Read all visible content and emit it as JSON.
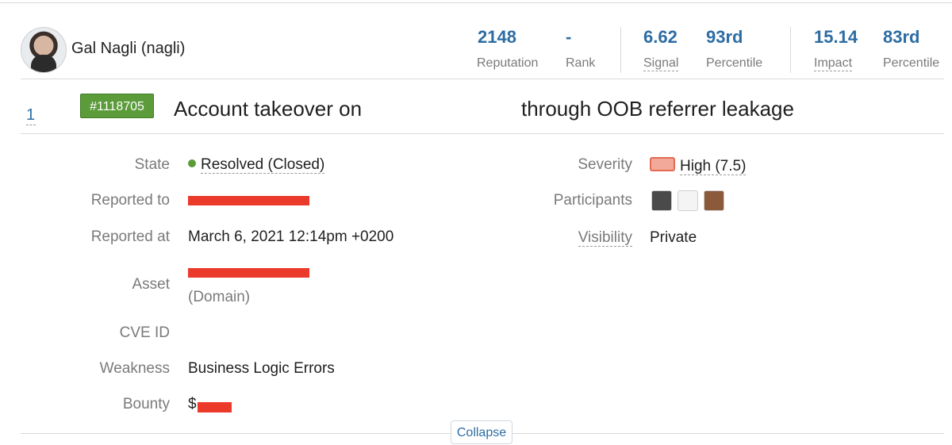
{
  "profile": {
    "username": "Gal Nagli (nagli)",
    "avatar": "profile-avatar"
  },
  "stats": [
    {
      "value": "2148",
      "label": "Reputation"
    },
    {
      "value": "-",
      "label": "Rank"
    },
    {
      "value": "6.62",
      "label": "Signal"
    },
    {
      "value": "93rd",
      "label": "Percentile"
    },
    {
      "value": "15.14",
      "label": "Impact"
    },
    {
      "value": "83rd",
      "label": "Percentile"
    }
  ],
  "report": {
    "row_number": "1",
    "id_badge": "#1118705",
    "title_part1": "Account takeover on",
    "title_part2": "through OOB referrer leakage"
  },
  "details_left": {
    "state_label": "State",
    "state_value": "Resolved (Closed)",
    "reported_to_label": "Reported to",
    "reported_at_label": "Reported at",
    "reported_at_value": "March 6, 2021 12:14pm +0200",
    "asset_label": "Asset",
    "asset_type": "(Domain)",
    "cve_label": "CVE ID",
    "weakness_label": "Weakness",
    "weakness_value": "Business Logic Errors",
    "bounty_label": "Bounty",
    "bounty_prefix": "$"
  },
  "details_right": {
    "severity_label": "Severity",
    "severity_value": "High (7.5)",
    "participants_label": "Participants",
    "visibility_label": "Visibility",
    "visibility_value": "Private"
  },
  "collapse_label": "Collapse",
  "colors": {
    "accent": "#2d6da3",
    "badge": "#5b9b3a",
    "redaction": "#ec3a2a"
  }
}
